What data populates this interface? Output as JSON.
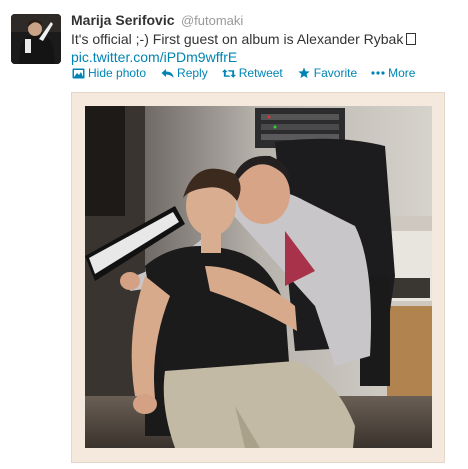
{
  "tweet": {
    "author": {
      "fullname": "Marija Serifovic",
      "username": "@futomaki",
      "avatar_icon": "user-avatar"
    },
    "text_line1": "It's official ;-) First guest on album is Alexander Rybak",
    "link": "pic.twitter.com/iPDm9wffrE",
    "actions": {
      "hide_photo": "Hide photo",
      "reply": "Reply",
      "retweet": "Retweet",
      "favorite": "Favorite",
      "more": "More"
    },
    "icons": {
      "hide_photo": "image-icon",
      "reply": "reply-arrow-icon",
      "retweet": "retweet-icon",
      "favorite": "star-icon",
      "more": "ellipsis-icon"
    }
  },
  "colors": {
    "link": "#0084b4",
    "fullname": "#333333",
    "username": "#999999",
    "photo_frame": "#f5e8dd"
  }
}
